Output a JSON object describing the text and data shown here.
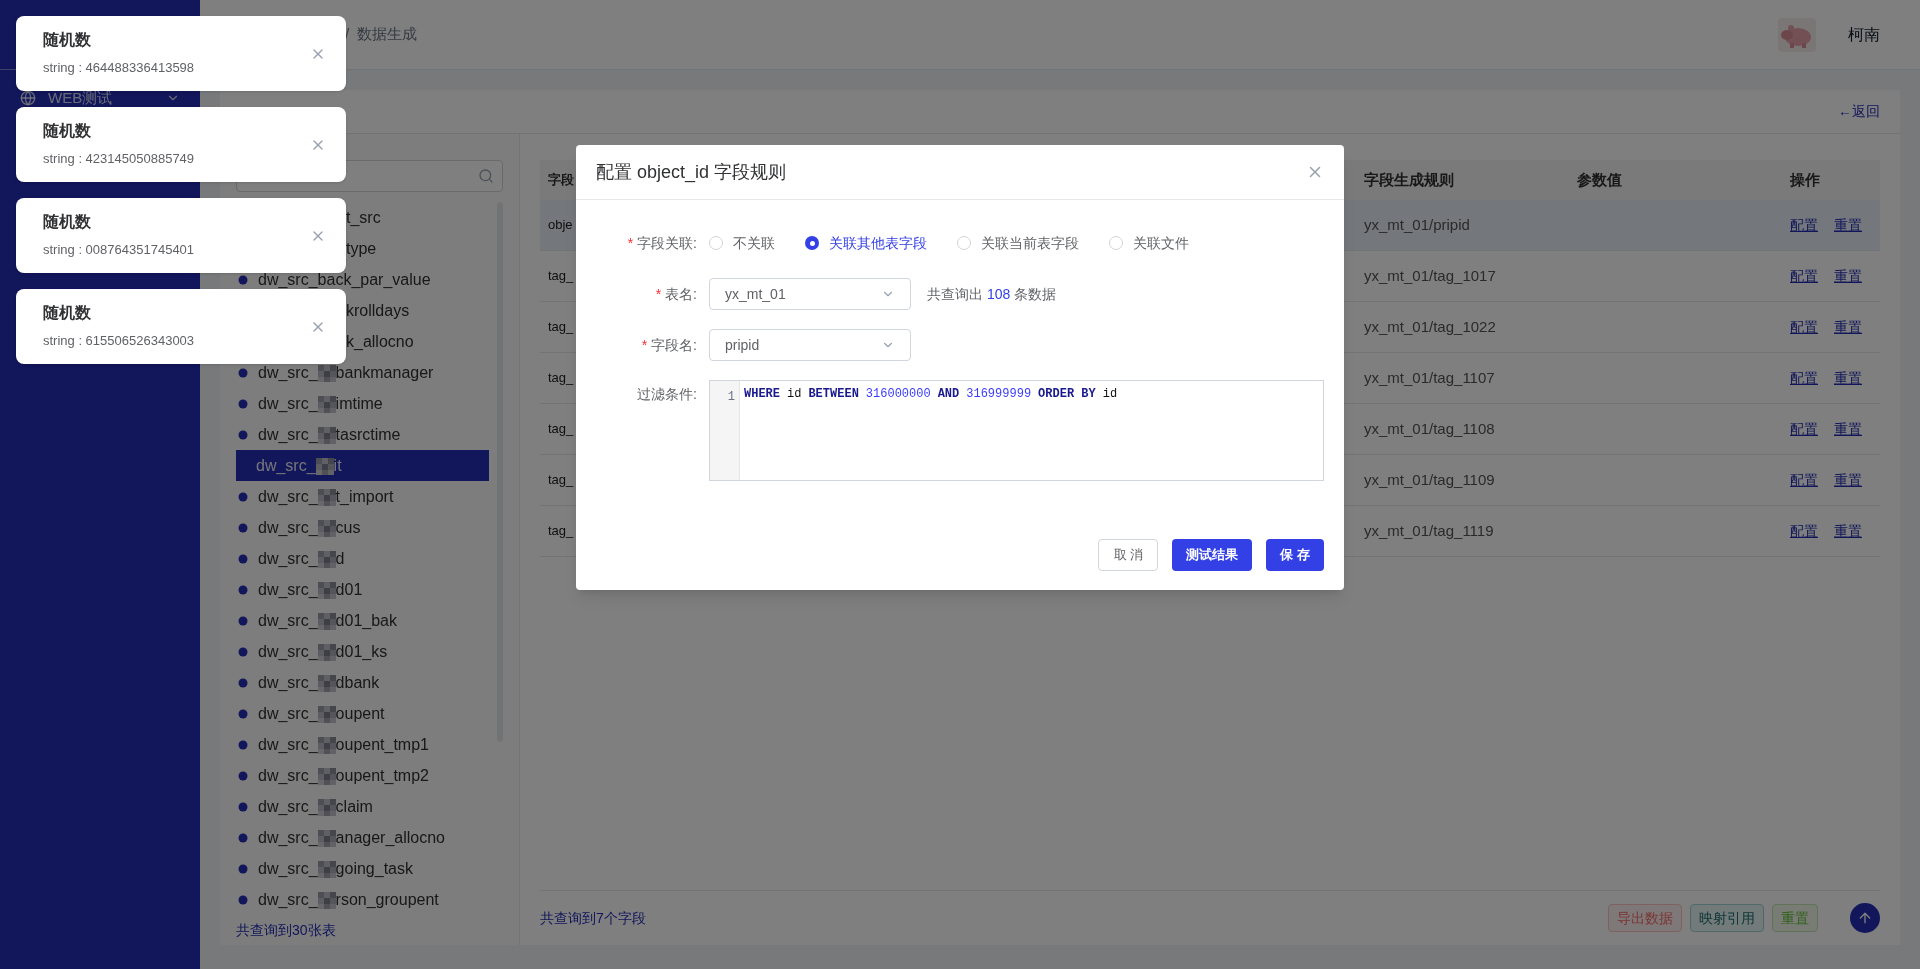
{
  "notifications": [
    {
      "title": "随机数",
      "body": "string : 464488336413598"
    },
    {
      "title": "随机数",
      "body": "string : 423145050885749"
    },
    {
      "title": "随机数",
      "body": "string : 008764351745401"
    },
    {
      "title": "随机数",
      "body": "string : 615506526343003"
    }
  ],
  "sidebar": {
    "items": [
      {
        "label": "WEB测试",
        "expanded": false
      }
    ]
  },
  "header": {
    "breadcrumb": [
      "/",
      "数据生成"
    ],
    "user": "柯南"
  },
  "page": {
    "back_link": "←返回"
  },
  "tables_panel": {
    "items": [
      {
        "name_end": "t_src",
        "selected": false
      },
      {
        "name_end": "type",
        "selected": false
      },
      {
        "name_start": "dw_src_back_par_value",
        "selected": false
      },
      {
        "name_end": "krolldays",
        "selected": false
      },
      {
        "name_end": "k_allocno",
        "selected": false
      },
      {
        "name_start": "dw_src_",
        "name_end": "bankmanager",
        "selected": false
      },
      {
        "name_start": "dw_src_",
        "name_end": "imtime",
        "selected": false
      },
      {
        "name_start": "dw_src_",
        "name_end": "tasrctime",
        "selected": false
      },
      {
        "name_start": "dw_src_",
        "name_end": "it",
        "selected": true
      },
      {
        "name_start": "dw_src_",
        "name_end": "t_import",
        "selected": false
      },
      {
        "name_start": "dw_src_",
        "name_end": "cus",
        "selected": false
      },
      {
        "name_start": "dw_src_",
        "name_end": "d",
        "selected": false
      },
      {
        "name_start": "dw_src_",
        "name_end": "d01",
        "selected": false
      },
      {
        "name_start": "dw_src_",
        "name_end": "d01_bak",
        "selected": false
      },
      {
        "name_start": "dw_src_",
        "name_end": "d01_ks",
        "selected": false
      },
      {
        "name_start": "dw_src_",
        "name_end": "dbank",
        "selected": false
      },
      {
        "name_start": "dw_src_",
        "name_end": "oupent",
        "selected": false
      },
      {
        "name_start": "dw_src_",
        "name_end": "oupent_tmp1",
        "selected": false
      },
      {
        "name_start": "dw_src_",
        "name_end": "oupent_tmp2",
        "selected": false
      },
      {
        "name_start": "dw_src_",
        "name_end": "claim",
        "selected": false
      },
      {
        "name_start": "dw_src_",
        "name_end": "anager_allocno",
        "selected": false
      },
      {
        "name_start": "dw_src_",
        "name_end": "going_task",
        "selected": false
      },
      {
        "name_start": "dw_src_",
        "name_end": "rson_groupent",
        "selected": false
      }
    ],
    "footer": "共查询到30张表"
  },
  "fields_table": {
    "columns": [
      "字段",
      "字段生成规则",
      "参数值",
      "操作"
    ],
    "rows": [
      {
        "field": "obje",
        "rule": "yx_mt_01/pripid",
        "actions": [
          "配置",
          "重置"
        ],
        "selected": true
      },
      {
        "field": "tag_",
        "rule": "yx_mt_01/tag_1017",
        "actions": [
          "配置",
          "重置"
        ],
        "selected": false
      },
      {
        "field": "tag_",
        "rule": "yx_mt_01/tag_1022",
        "actions": [
          "配置",
          "重置"
        ],
        "selected": false
      },
      {
        "field": "tag_",
        "rule": "yx_mt_01/tag_1107",
        "actions": [
          "配置",
          "重置"
        ],
        "selected": false
      },
      {
        "field": "tag_",
        "rule": "yx_mt_01/tag_1108",
        "actions": [
          "配置",
          "重置"
        ],
        "selected": false
      },
      {
        "field": "tag_",
        "rule": "yx_mt_01/tag_1109",
        "actions": [
          "配置",
          "重置"
        ],
        "selected": false
      },
      {
        "field": "tag_",
        "rule": "yx_mt_01/tag_1119",
        "actions": [
          "配置",
          "重置"
        ],
        "selected": false
      }
    ],
    "footer": "共查询到7个字段",
    "buttons": [
      {
        "label": "导出数据",
        "kind": "danger"
      },
      {
        "label": "映射引用",
        "kind": "info"
      },
      {
        "label": "重置",
        "kind": "success"
      }
    ]
  },
  "modal": {
    "title": "配置 object_id 字段规则",
    "relation": {
      "required_mark": "*",
      "label": "字段关联:",
      "options": [
        {
          "label": "不关联",
          "selected": false
        },
        {
          "label": "关联其他表字段",
          "selected": true
        },
        {
          "label": "关联当前表字段",
          "selected": false
        },
        {
          "label": "关联文件",
          "selected": false
        }
      ]
    },
    "table_name": {
      "required_mark": "*",
      "label": "表名:",
      "value": "yx_mt_01",
      "hint_before": "共查询出",
      "count": "108",
      "hint_after": "条数据"
    },
    "field_name": {
      "required_mark": "*",
      "label": "字段名:",
      "value": "pripid"
    },
    "filter": {
      "label": "过滤条件:",
      "line_number": "1",
      "tokens": [
        {
          "text": "WHERE",
          "kind": "keyword"
        },
        {
          "text": "id",
          "kind": "ident"
        },
        {
          "text": "BETWEEN",
          "kind": "keyword"
        },
        {
          "text": "316000000",
          "kind": "number"
        },
        {
          "text": "AND",
          "kind": "keyword"
        },
        {
          "text": "316999999",
          "kind": "number"
        },
        {
          "text": "ORDER BY",
          "kind": "keyword"
        },
        {
          "text": "id",
          "kind": "ident"
        }
      ]
    },
    "buttons": [
      {
        "label": "取 消",
        "kind": "default"
      },
      {
        "label": "测试结果",
        "kind": "primary"
      },
      {
        "label": "保 存",
        "kind": "primary"
      }
    ]
  }
}
